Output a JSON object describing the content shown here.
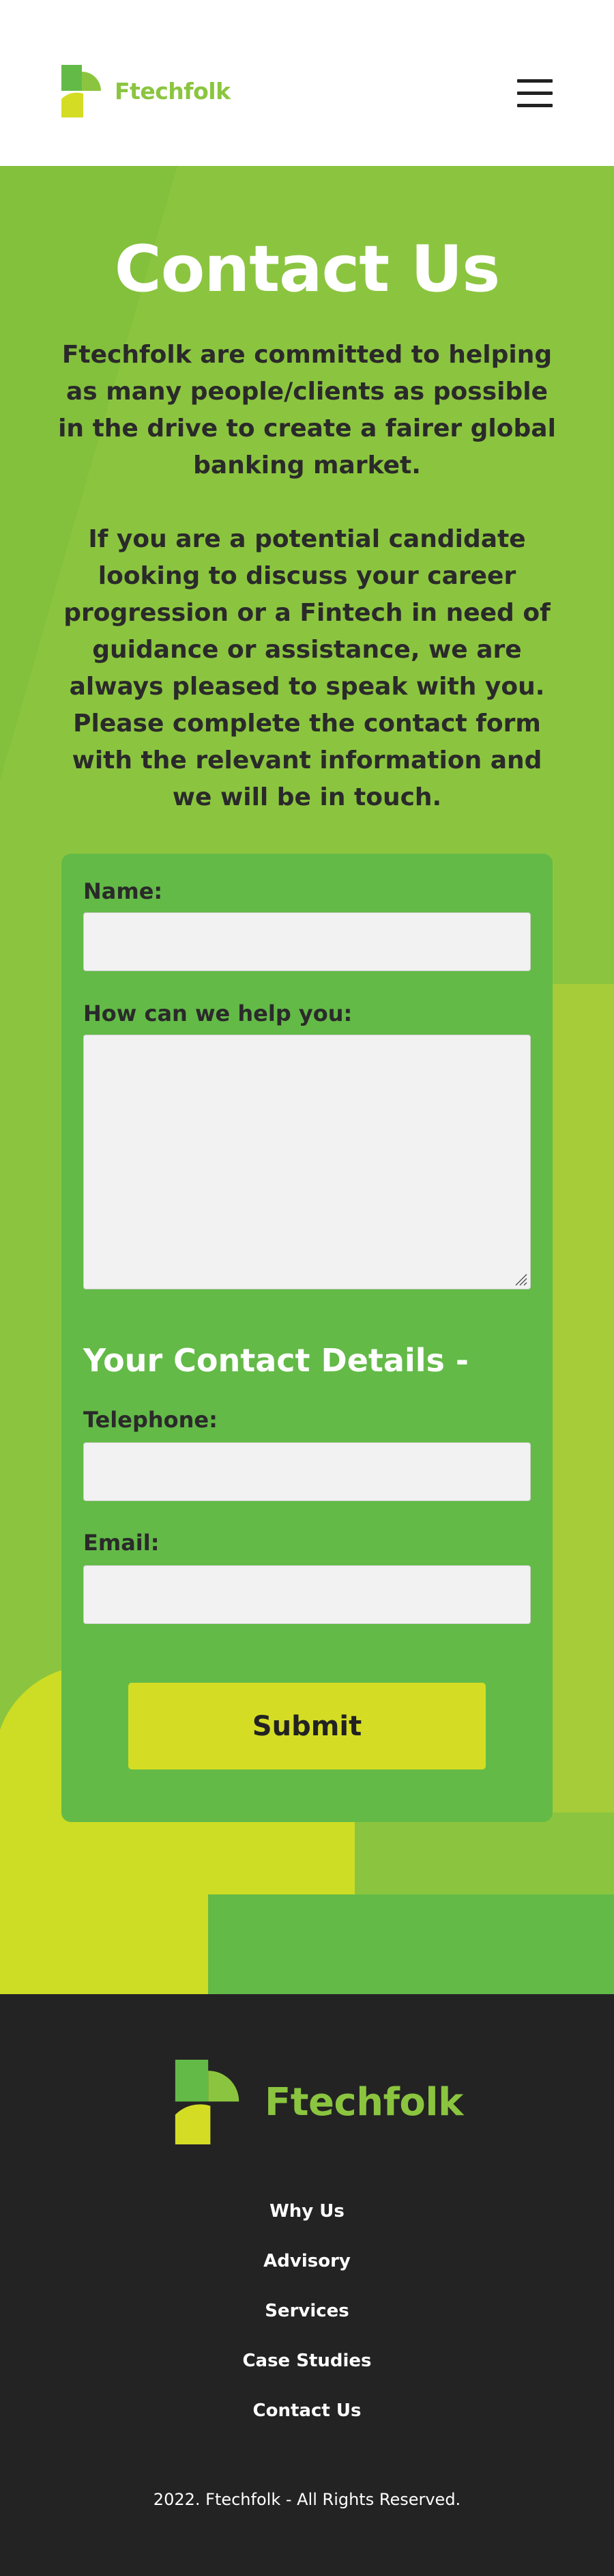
{
  "brand": {
    "name": "Ftechfolk",
    "colors": {
      "primary_green": "#8bc53f",
      "card_green": "#63ba47",
      "lime": "#d4dd24",
      "dark": "#232323"
    }
  },
  "header": {
    "menu_icon": "hamburger-menu-icon"
  },
  "main": {
    "title": "Contact Us",
    "paragraphs": [
      "Ftechfolk are committed to helping as many people/clients as possible in the drive to create a fairer global banking market.",
      "If you are a potential candidate looking to discuss your career progression or a Fintech in need of guidance or assistance, we are always pleased to speak with you.",
      "Please complete the contact form with the relevant information and we will be in touch."
    ]
  },
  "form": {
    "name_label": "Name:",
    "name_value": "",
    "help_label": "How can we help you:",
    "help_value": "",
    "contact_heading": "Your Contact Details -",
    "telephone_label": "Telephone:",
    "telephone_value": "",
    "email_label": "Email:",
    "email_value": "",
    "submit_label": "Submit"
  },
  "footer": {
    "nav": [
      "Why Us",
      "Advisory",
      "Services",
      "Case Studies",
      "Contact Us"
    ],
    "copyright": "2022. Ftechfolk - All Rights Reserved."
  }
}
